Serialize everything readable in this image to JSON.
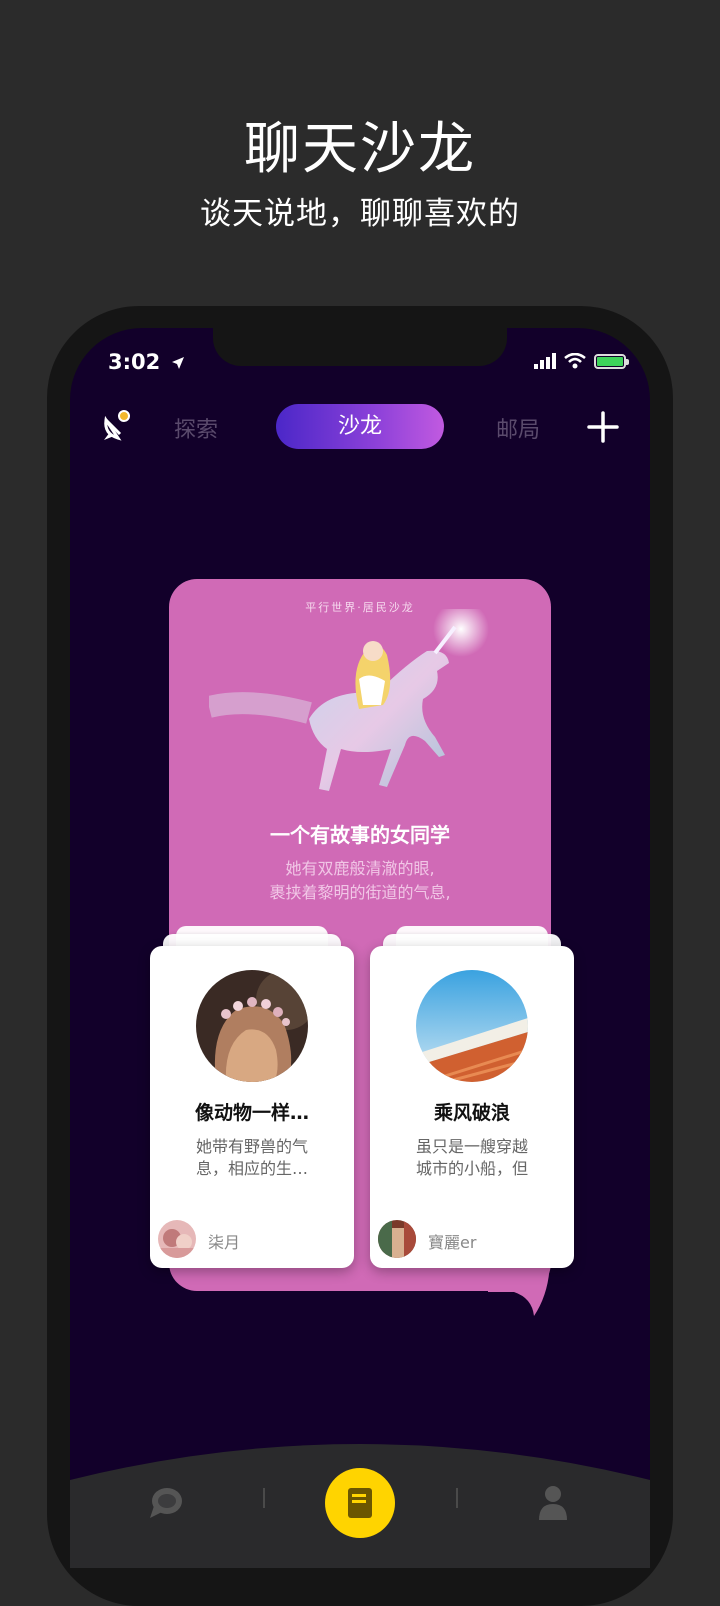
{
  "promo": {
    "title": "聊天沙龙",
    "subtitle": "谈天说地，聊聊喜欢的"
  },
  "status_bar": {
    "time": "3:02",
    "icons": [
      "location-arrow-icon",
      "signal-icon",
      "wifi-icon",
      "battery-icon"
    ],
    "battery_color": "#3ed35a"
  },
  "nav": {
    "logo_icon": "satellite-dish-icon",
    "tabs": [
      {
        "label": "探索",
        "active": false
      },
      {
        "label": "沙龙",
        "active": true
      },
      {
        "label": "邮局",
        "active": false
      }
    ],
    "add_icon": "plus-icon"
  },
  "featured_card": {
    "label": "平行世界·居民沙龙",
    "title": "一个有故事的女同学",
    "description_lines": [
      "她有双鹿般清澈的眼,",
      "裹挟着黎明的街道的气息,"
    ],
    "background_color": "#d06ab6"
  },
  "sub_cards": [
    {
      "title": "像动物一样…",
      "description_lines": [
        "她带有野兽的气",
        "息，相应的生…"
      ],
      "author": "柒月"
    },
    {
      "title": "乘风破浪",
      "description_lines": [
        "虽只是一艘穿越",
        "城市的小船，但"
      ],
      "author": "寶麗er"
    }
  ],
  "bottom_bar": {
    "items": [
      "chat-bubble-icon",
      "notebook-icon",
      "user-icon"
    ],
    "accent_color": "#ffd400"
  }
}
